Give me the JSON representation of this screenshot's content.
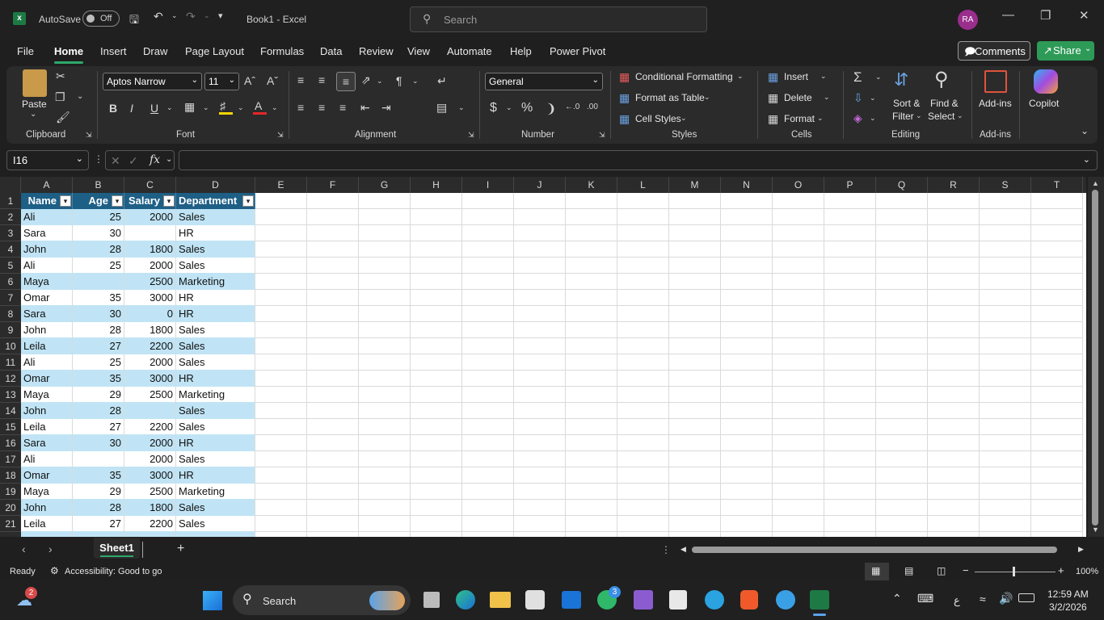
{
  "titlebar": {
    "autosave_label": "AutoSave",
    "autosave_state": "Off",
    "doc_title": "Book1  -  Excel",
    "search_placeholder": "Search",
    "user_initials": "RA"
  },
  "menu": {
    "items": [
      "File",
      "Home",
      "Insert",
      "Draw",
      "Page Layout",
      "Formulas",
      "Data",
      "Review",
      "View",
      "Automate",
      "Help",
      "Power Pivot"
    ],
    "comments_label": "Comments",
    "share_label": "Share"
  },
  "ribbon": {
    "clipboard": {
      "paste_label": "Paste",
      "group_label": "Clipboard"
    },
    "font": {
      "family": "Aptos Narrow",
      "size": "11",
      "group_label": "Font",
      "bold": "B",
      "italic": "I",
      "underline": "U"
    },
    "alignment": {
      "group_label": "Alignment"
    },
    "number": {
      "format": "General",
      "group_label": "Number",
      "currency": "$",
      "percent": "%"
    },
    "styles": {
      "conditional_formatting": "Conditional Formatting",
      "format_as_table": "Format as Table",
      "cell_styles": "Cell Styles",
      "group_label": "Styles"
    },
    "cells": {
      "insert": "Insert",
      "delete": "Delete",
      "format": "Format",
      "group_label": "Cells"
    },
    "editing": {
      "sort_filter_1": "Sort &",
      "sort_filter_2": "Filter",
      "find_select_1": "Find &",
      "find_select_2": "Select",
      "group_label": "Editing"
    },
    "addins": {
      "label": "Add-ins",
      "group_label": "Add-ins"
    },
    "copilot": {
      "label": "Copilot"
    }
  },
  "formula_bar": {
    "name_box": "I16",
    "fx": "fx",
    "formula": ""
  },
  "grid": {
    "columns": [
      "A",
      "B",
      "C",
      "D",
      "E",
      "F",
      "G",
      "H",
      "I",
      "J",
      "K",
      "L",
      "M",
      "N",
      "O",
      "P",
      "Q",
      "R",
      "S",
      "T"
    ],
    "table_headers": [
      "Name",
      "Age",
      "Salary",
      "Department"
    ],
    "rows": [
      [
        "Ali",
        "25",
        "2000",
        "Sales"
      ],
      [
        "Sara",
        "30",
        "",
        "HR"
      ],
      [
        "John",
        "28",
        "1800",
        "Sales"
      ],
      [
        "Ali",
        "25",
        "2000",
        "Sales"
      ],
      [
        "Maya",
        "",
        "2500",
        "Marketing"
      ],
      [
        "Omar",
        "35",
        "3000",
        "HR"
      ],
      [
        "Sara",
        "30",
        "0",
        "HR"
      ],
      [
        "John",
        "28",
        "1800",
        "Sales"
      ],
      [
        "Leila",
        "27",
        "2200",
        "Sales"
      ],
      [
        "Ali",
        "25",
        "2000",
        "Sales"
      ],
      [
        "Omar",
        "35",
        "3000",
        "HR"
      ],
      [
        "Maya",
        "29",
        "2500",
        "Marketing"
      ],
      [
        "John",
        "28",
        "",
        "Sales"
      ],
      [
        "Leila",
        "27",
        "2200",
        "Sales"
      ],
      [
        "Sara",
        "30",
        "2000",
        "HR"
      ],
      [
        "Ali",
        "",
        "2000",
        "Sales"
      ],
      [
        "Omar",
        "35",
        "3000",
        "HR"
      ],
      [
        "Maya",
        "29",
        "2500",
        "Marketing"
      ],
      [
        "John",
        "28",
        "1800",
        "Sales"
      ],
      [
        "Leila",
        "27",
        "2200",
        "Sales"
      ]
    ],
    "row_numbers": [
      "1",
      "2",
      "3",
      "4",
      "5",
      "6",
      "7",
      "8",
      "9",
      "10",
      "11",
      "12",
      "13",
      "14",
      "15",
      "16",
      "17",
      "18",
      "19",
      "20",
      "21"
    ]
  },
  "sheets": {
    "tabs": [
      "Sheet1"
    ],
    "add": "+"
  },
  "statusbar": {
    "ready": "Ready",
    "accessibility": "Accessibility: Good to go",
    "zoom": "100%"
  },
  "taskbar": {
    "search_label": "Search",
    "time": "12:59 AM",
    "date": "3/2/2026",
    "lang": "ع",
    "weather_badge": "2",
    "notif_badge": "3"
  }
}
